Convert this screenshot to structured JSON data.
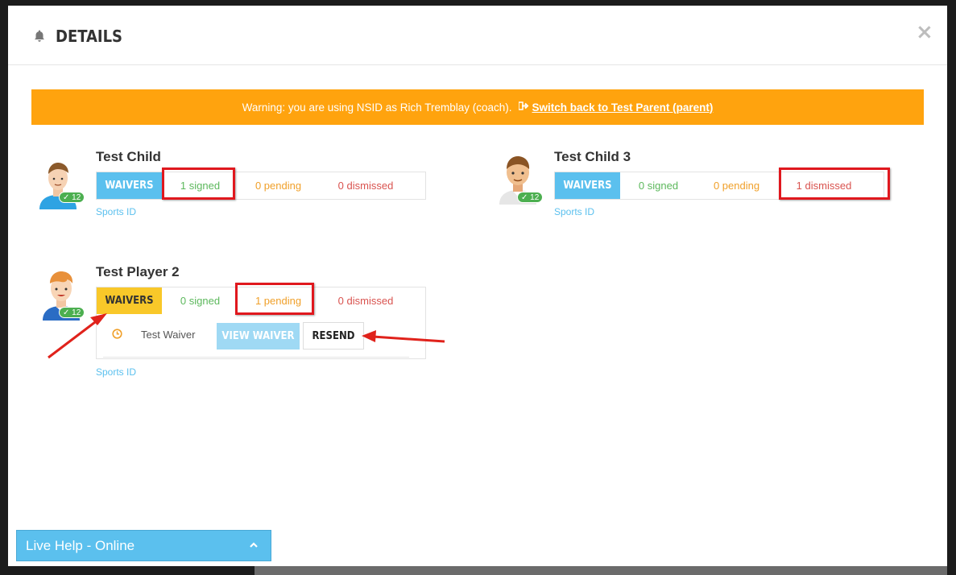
{
  "modal": {
    "title": "DETAILS",
    "close_glyph": "×"
  },
  "warning": {
    "text": "Warning: you are using NSID as Rich Tremblay (coach).",
    "switch_label": "Switch back to Test Parent (parent)",
    "switch_icon": "sign-out-icon"
  },
  "players": [
    {
      "name": "Test Child",
      "badge": "12",
      "waivers_label": "WAIVERS",
      "signed": "1 signed",
      "pending": "0 pending",
      "dismissed": "0 dismissed",
      "sports_id": "Sports ID"
    },
    {
      "name": "Test Child 3",
      "badge": "12",
      "waivers_label": "WAIVERS",
      "signed": "0 signed",
      "pending": "0 pending",
      "dismissed": "1 dismissed",
      "sports_id": "Sports ID"
    },
    {
      "name": "Test Player 2",
      "badge": "12",
      "waivers_label": "WAIVERS",
      "signed": "0 signed",
      "pending": "1 pending",
      "dismissed": "0 dismissed",
      "sports_id": "Sports ID",
      "waiver": {
        "name": "Test Waiver",
        "view_label": "VIEW WAIVER",
        "resend_label": "RESEND",
        "status_icon": "clock-icon"
      }
    }
  ],
  "live_help": {
    "label": "Live Help - Online"
  },
  "colors": {
    "accent": "#5bc0ee",
    "warning": "#ffa30e",
    "active_tab": "#f9c829",
    "signed": "#5cb85c",
    "pending": "#f0a02a",
    "dismissed": "#d9534f",
    "highlight": "#e0181e"
  }
}
